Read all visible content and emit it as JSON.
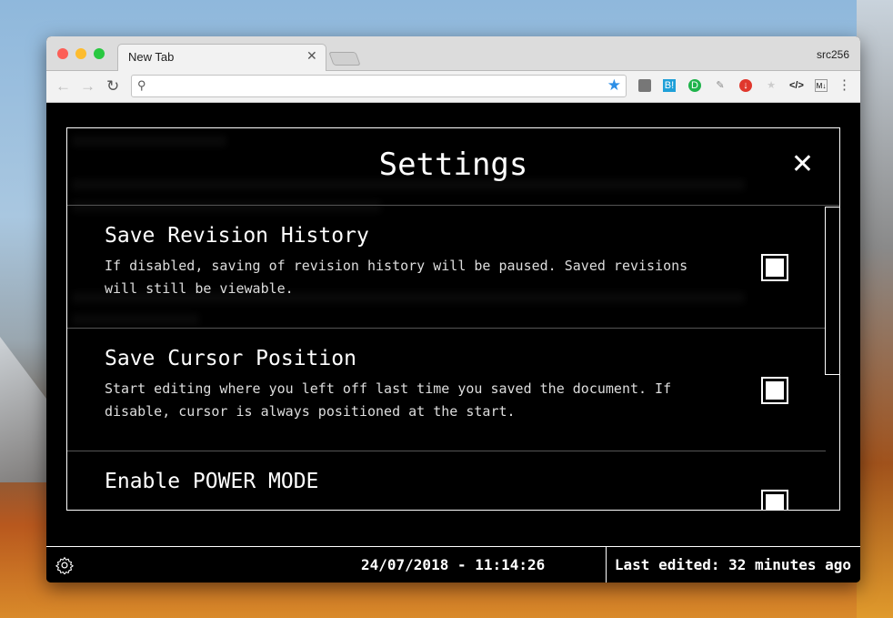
{
  "browser": {
    "tab_title": "New Tab",
    "profile": "src256",
    "omnibox_value": ""
  },
  "settings": {
    "title": "Settings",
    "close": "✕",
    "items": [
      {
        "title": "Save Revision History",
        "description": "If disabled, saving of revision history will be paused. Saved revisions will still be viewable.",
        "checked": true
      },
      {
        "title": "Save Cursor Position",
        "description": "Start editing where you left off last time you saved the document. If disable, cursor is always positioned at the start.",
        "checked": true
      },
      {
        "title": "Enable POWER MODE",
        "description": "",
        "checked": true
      }
    ]
  },
  "footer": {
    "datetime": "24/07/2018 - 11:14:26",
    "last_edited": "Last edited: 32 minutes ago"
  }
}
